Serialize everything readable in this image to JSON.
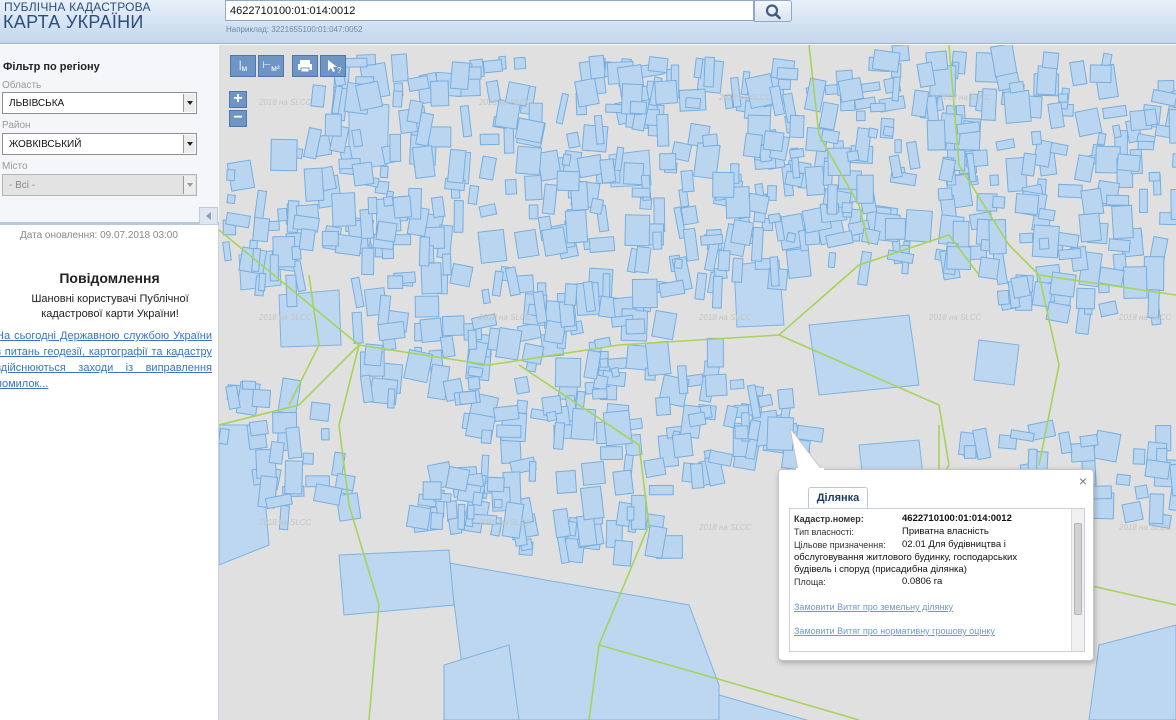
{
  "header": {
    "logo_line1": "ПУБЛІЧНА КАДАСТРОВА",
    "logo_line2": "КАРТА УКРАЇНИ",
    "search_value": "4622710100:01:014:0012",
    "search_hint": "Наприклад: 3221655100:01:047:0052",
    "search_icon": "search-icon"
  },
  "sidebar": {
    "filter_title": "Фільтр по регіону",
    "region_label": "Область",
    "region_value": "ЛЬВІВСЬКА",
    "district_label": "Район",
    "district_value": "ЖОВКІВСЬКИЙ",
    "city_label": "Місто",
    "city_value": "- Всі -",
    "update_date": "Дата оновлення: 09.07.2018 03:00",
    "notice_title": "Повідомлення",
    "notice_body": "Шановні користувачі Публічної кадастрової карти України!",
    "notice_link": "На сьогодні Державною службою України з питань геодезії, картографії та кадастру здійснюються заходи із виправлення помилок..."
  },
  "toolbar": {
    "ruler_label": "м",
    "area_label": "м²",
    "print_icon": "print-icon",
    "identify_icon": "identify-cursor-icon",
    "zoom_in": "+",
    "zoom_out": "−"
  },
  "map": {
    "watermark": "2018 на SLCC",
    "parcel_fill": "#b9d5ef",
    "parcel_stroke": "#77aedf",
    "boundary_color": "#a6d35a",
    "background": "#e0e0e0"
  },
  "popup": {
    "close": "×",
    "tab_label": "Ділянка",
    "cadastral_label": "Кадастр.номер:",
    "cadastral_value": "4622710100:01:014:0012",
    "ownership_label": "Тип власності:",
    "ownership_value": "Приватна власність",
    "purpose_label": "Цільове призначення:",
    "purpose_line1": "02.01 Для будівництва і",
    "purpose_line2": "обслуговування житлового будинку, господарських",
    "purpose_line3": "будівель і споруд (присадибна ділянка)",
    "area_label": "Площа:",
    "area_value": "0.0806 га",
    "link_extract": "Замовити Витяг про земельну ділянку",
    "link_valuation": "Замовити Витяг про нормативну грошову оцінку"
  }
}
